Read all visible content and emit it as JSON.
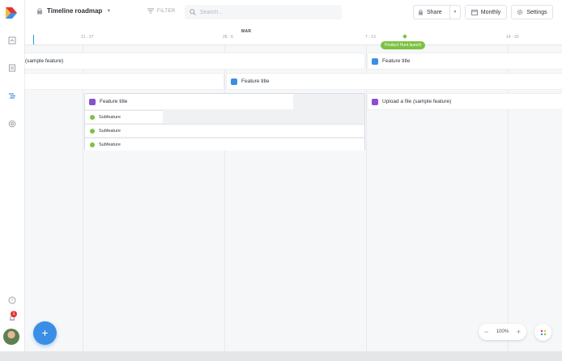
{
  "colors": {
    "blue": "#3a8ee6",
    "purple": "#8a4fd1",
    "green": "#7cc243",
    "badge": "#e5322d"
  },
  "topbar": {
    "title": "Timeline roadmap",
    "filter_label": "FILTER",
    "search_placeholder": "Search...",
    "share_label": "Share",
    "monthly_label": "Monthly",
    "settings_label": "Settings"
  },
  "timeline": {
    "month": "MAR",
    "weeks": [
      "21 - 27",
      "28 - 6",
      "7 - 13",
      "14 - 20"
    ],
    "milestone": "Product Hunt launch"
  },
  "bars": {
    "row1_left": "(sample feature)",
    "row1_right": "Feature title",
    "row2_right": "Feature title",
    "group_title": "Feature title",
    "group_right": "Upload a file (sample feature)",
    "subfeatures": [
      "Subfeature",
      "Subfeature",
      "Subfeature"
    ]
  },
  "sidebar": {
    "notification_count": "1"
  },
  "zoom": {
    "level": "100%",
    "minus": "−",
    "plus": "+"
  },
  "fab_label": "+"
}
